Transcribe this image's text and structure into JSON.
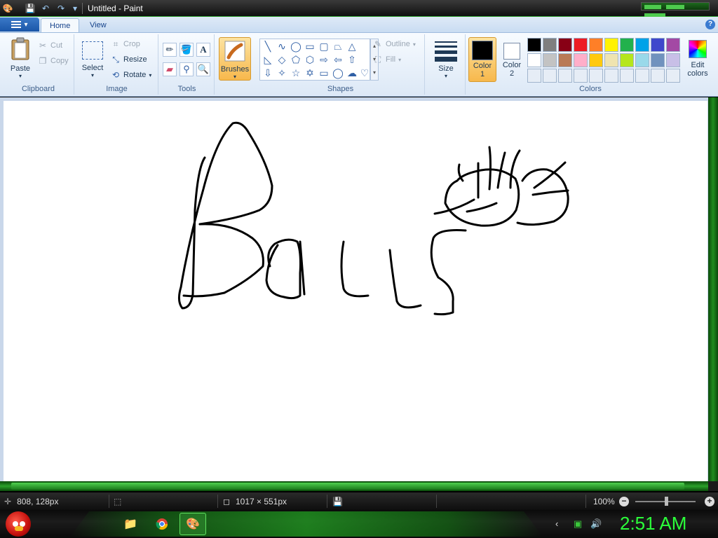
{
  "window": {
    "title": "Untitled - Paint",
    "quick_access": [
      "save-icon",
      "undo-icon",
      "redo-icon",
      "customize-icon"
    ]
  },
  "ribbon_tabs": {
    "home": "Home",
    "view": "View"
  },
  "clipboard": {
    "paste": "Paste",
    "cut": "Cut",
    "copy": "Copy",
    "label": "Clipboard"
  },
  "image": {
    "select": "Select",
    "crop": "Crop",
    "resize": "Resize",
    "rotate": "Rotate",
    "label": "Image"
  },
  "tools": {
    "label": "Tools",
    "items": [
      "pencil-icon",
      "fill-icon",
      "text-icon",
      "eraser-icon",
      "color-picker-icon",
      "magnifier-icon"
    ]
  },
  "brushes": {
    "label": "Brushes"
  },
  "shapes": {
    "label": "Shapes",
    "outline": "Outline",
    "fill": "Fill"
  },
  "size": {
    "label": "Size"
  },
  "colors": {
    "label": "Colors",
    "color1_label_line1": "Color",
    "color1_label_line2": "1",
    "color2_label_line1": "Color",
    "color2_label_line2": "2",
    "color1_value": "#000000",
    "color2_value": "#ffffff",
    "edit_line1": "Edit",
    "edit_line2": "colors",
    "palette_row1": [
      "#000000",
      "#7f7f7f",
      "#880015",
      "#ed1c24",
      "#ff7f27",
      "#fff200",
      "#22b14c",
      "#00a2e8",
      "#3f48cc",
      "#a349a4"
    ],
    "palette_row2": [
      "#ffffff",
      "#c3c3c3",
      "#b97a57",
      "#ffaec9",
      "#ffc90e",
      "#efe4b0",
      "#b5e61d",
      "#99d9ea",
      "#7092be",
      "#c8bfe7"
    ],
    "palette_row3": [
      "#e6edf6",
      "#e6edf6",
      "#e6edf6",
      "#e6edf6",
      "#e6edf6",
      "#e6edf6",
      "#e6edf6",
      "#e6edf6",
      "#e6edf6",
      "#e6edf6"
    ]
  },
  "status": {
    "cursor_pos": "808, 128px",
    "canvas_size": "1017 × 551px",
    "zoom": "100%"
  },
  "taskbar": {
    "time": "2:51 AM"
  },
  "theme": {
    "accent": "#22aa22",
    "clock_color": "#2bff3a"
  }
}
